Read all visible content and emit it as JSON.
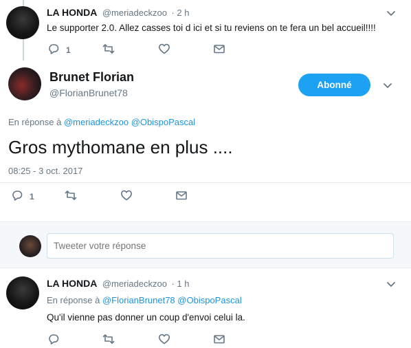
{
  "parent_tweet": {
    "name": "LA HONDA",
    "handle": "@meriadeckzoo",
    "time": "· 2 h",
    "text": "Le supporter 2.0. Allez casses toi d ici et si tu reviens on te fera un bel accueil!!!!",
    "reply_count": "1"
  },
  "main_tweet": {
    "name": "Brunet Florian",
    "handle": "@FlorianBrunet78",
    "follow_label": "Abonné",
    "reply_prefix": "En réponse à",
    "reply_mention_1": "@meriadeckzoo",
    "reply_mention_2": "@ObispoPascal",
    "text": "Gros mythomane en plus ....",
    "datetime": "08:25 - 3 oct. 2017",
    "reply_count": "1"
  },
  "reply_box": {
    "placeholder": "Tweeter votre réponse"
  },
  "reply_tweet": {
    "name": "LA HONDA",
    "handle": "@meriadeckzoo",
    "time": "· 1 h",
    "reply_prefix": "En réponse à",
    "reply_mention_1": "@FlorianBrunet78",
    "reply_mention_2": "@ObispoPascal",
    "text": "Qu'il vienne pas donner un coup d'envoi celui la."
  },
  "icons": [
    "reply-icon",
    "retweet-icon",
    "like-icon",
    "direct-message-icon",
    "chevron-down-icon"
  ],
  "colors": {
    "accent": "#1da1f2",
    "link": "#1b95e0",
    "muted": "#657786",
    "text": "#14171a"
  }
}
